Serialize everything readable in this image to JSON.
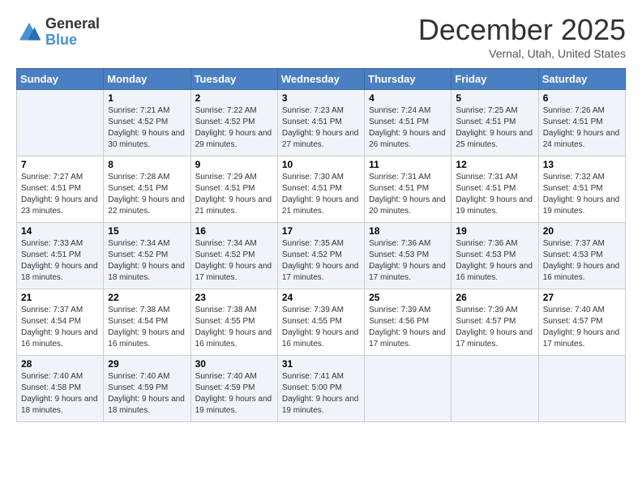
{
  "logo": {
    "general": "General",
    "blue": "Blue"
  },
  "title": "December 2025",
  "location": "Vernal, Utah, United States",
  "days_of_week": [
    "Sunday",
    "Monday",
    "Tuesday",
    "Wednesday",
    "Thursday",
    "Friday",
    "Saturday"
  ],
  "weeks": [
    [
      {
        "day": "",
        "sunrise": "",
        "sunset": "",
        "daylight": ""
      },
      {
        "day": "1",
        "sunrise": "Sunrise: 7:21 AM",
        "sunset": "Sunset: 4:52 PM",
        "daylight": "Daylight: 9 hours and 30 minutes."
      },
      {
        "day": "2",
        "sunrise": "Sunrise: 7:22 AM",
        "sunset": "Sunset: 4:52 PM",
        "daylight": "Daylight: 9 hours and 29 minutes."
      },
      {
        "day": "3",
        "sunrise": "Sunrise: 7:23 AM",
        "sunset": "Sunset: 4:51 PM",
        "daylight": "Daylight: 9 hours and 27 minutes."
      },
      {
        "day": "4",
        "sunrise": "Sunrise: 7:24 AM",
        "sunset": "Sunset: 4:51 PM",
        "daylight": "Daylight: 9 hours and 26 minutes."
      },
      {
        "day": "5",
        "sunrise": "Sunrise: 7:25 AM",
        "sunset": "Sunset: 4:51 PM",
        "daylight": "Daylight: 9 hours and 25 minutes."
      },
      {
        "day": "6",
        "sunrise": "Sunrise: 7:26 AM",
        "sunset": "Sunset: 4:51 PM",
        "daylight": "Daylight: 9 hours and 24 minutes."
      }
    ],
    [
      {
        "day": "7",
        "sunrise": "Sunrise: 7:27 AM",
        "sunset": "Sunset: 4:51 PM",
        "daylight": "Daylight: 9 hours and 23 minutes."
      },
      {
        "day": "8",
        "sunrise": "Sunrise: 7:28 AM",
        "sunset": "Sunset: 4:51 PM",
        "daylight": "Daylight: 9 hours and 22 minutes."
      },
      {
        "day": "9",
        "sunrise": "Sunrise: 7:29 AM",
        "sunset": "Sunset: 4:51 PM",
        "daylight": "Daylight: 9 hours and 21 minutes."
      },
      {
        "day": "10",
        "sunrise": "Sunrise: 7:30 AM",
        "sunset": "Sunset: 4:51 PM",
        "daylight": "Daylight: 9 hours and 21 minutes."
      },
      {
        "day": "11",
        "sunrise": "Sunrise: 7:31 AM",
        "sunset": "Sunset: 4:51 PM",
        "daylight": "Daylight: 9 hours and 20 minutes."
      },
      {
        "day": "12",
        "sunrise": "Sunrise: 7:31 AM",
        "sunset": "Sunset: 4:51 PM",
        "daylight": "Daylight: 9 hours and 19 minutes."
      },
      {
        "day": "13",
        "sunrise": "Sunrise: 7:32 AM",
        "sunset": "Sunset: 4:51 PM",
        "daylight": "Daylight: 9 hours and 19 minutes."
      }
    ],
    [
      {
        "day": "14",
        "sunrise": "Sunrise: 7:33 AM",
        "sunset": "Sunset: 4:51 PM",
        "daylight": "Daylight: 9 hours and 18 minutes."
      },
      {
        "day": "15",
        "sunrise": "Sunrise: 7:34 AM",
        "sunset": "Sunset: 4:52 PM",
        "daylight": "Daylight: 9 hours and 18 minutes."
      },
      {
        "day": "16",
        "sunrise": "Sunrise: 7:34 AM",
        "sunset": "Sunset: 4:52 PM",
        "daylight": "Daylight: 9 hours and 17 minutes."
      },
      {
        "day": "17",
        "sunrise": "Sunrise: 7:35 AM",
        "sunset": "Sunset: 4:52 PM",
        "daylight": "Daylight: 9 hours and 17 minutes."
      },
      {
        "day": "18",
        "sunrise": "Sunrise: 7:36 AM",
        "sunset": "Sunset: 4:53 PM",
        "daylight": "Daylight: 9 hours and 17 minutes."
      },
      {
        "day": "19",
        "sunrise": "Sunrise: 7:36 AM",
        "sunset": "Sunset: 4:53 PM",
        "daylight": "Daylight: 9 hours and 16 minutes."
      },
      {
        "day": "20",
        "sunrise": "Sunrise: 7:37 AM",
        "sunset": "Sunset: 4:53 PM",
        "daylight": "Daylight: 9 hours and 16 minutes."
      }
    ],
    [
      {
        "day": "21",
        "sunrise": "Sunrise: 7:37 AM",
        "sunset": "Sunset: 4:54 PM",
        "daylight": "Daylight: 9 hours and 16 minutes."
      },
      {
        "day": "22",
        "sunrise": "Sunrise: 7:38 AM",
        "sunset": "Sunset: 4:54 PM",
        "daylight": "Daylight: 9 hours and 16 minutes."
      },
      {
        "day": "23",
        "sunrise": "Sunrise: 7:38 AM",
        "sunset": "Sunset: 4:55 PM",
        "daylight": "Daylight: 9 hours and 16 minutes."
      },
      {
        "day": "24",
        "sunrise": "Sunrise: 7:39 AM",
        "sunset": "Sunset: 4:55 PM",
        "daylight": "Daylight: 9 hours and 16 minutes."
      },
      {
        "day": "25",
        "sunrise": "Sunrise: 7:39 AM",
        "sunset": "Sunset: 4:56 PM",
        "daylight": "Daylight: 9 hours and 17 minutes."
      },
      {
        "day": "26",
        "sunrise": "Sunrise: 7:39 AM",
        "sunset": "Sunset: 4:57 PM",
        "daylight": "Daylight: 9 hours and 17 minutes."
      },
      {
        "day": "27",
        "sunrise": "Sunrise: 7:40 AM",
        "sunset": "Sunset: 4:57 PM",
        "daylight": "Daylight: 9 hours and 17 minutes."
      }
    ],
    [
      {
        "day": "28",
        "sunrise": "Sunrise: 7:40 AM",
        "sunset": "Sunset: 4:58 PM",
        "daylight": "Daylight: 9 hours and 18 minutes."
      },
      {
        "day": "29",
        "sunrise": "Sunrise: 7:40 AM",
        "sunset": "Sunset: 4:59 PM",
        "daylight": "Daylight: 9 hours and 18 minutes."
      },
      {
        "day": "30",
        "sunrise": "Sunrise: 7:40 AM",
        "sunset": "Sunset: 4:59 PM",
        "daylight": "Daylight: 9 hours and 19 minutes."
      },
      {
        "day": "31",
        "sunrise": "Sunrise: 7:41 AM",
        "sunset": "Sunset: 5:00 PM",
        "daylight": "Daylight: 9 hours and 19 minutes."
      },
      {
        "day": "",
        "sunrise": "",
        "sunset": "",
        "daylight": ""
      },
      {
        "day": "",
        "sunrise": "",
        "sunset": "",
        "daylight": ""
      },
      {
        "day": "",
        "sunrise": "",
        "sunset": "",
        "daylight": ""
      }
    ]
  ]
}
